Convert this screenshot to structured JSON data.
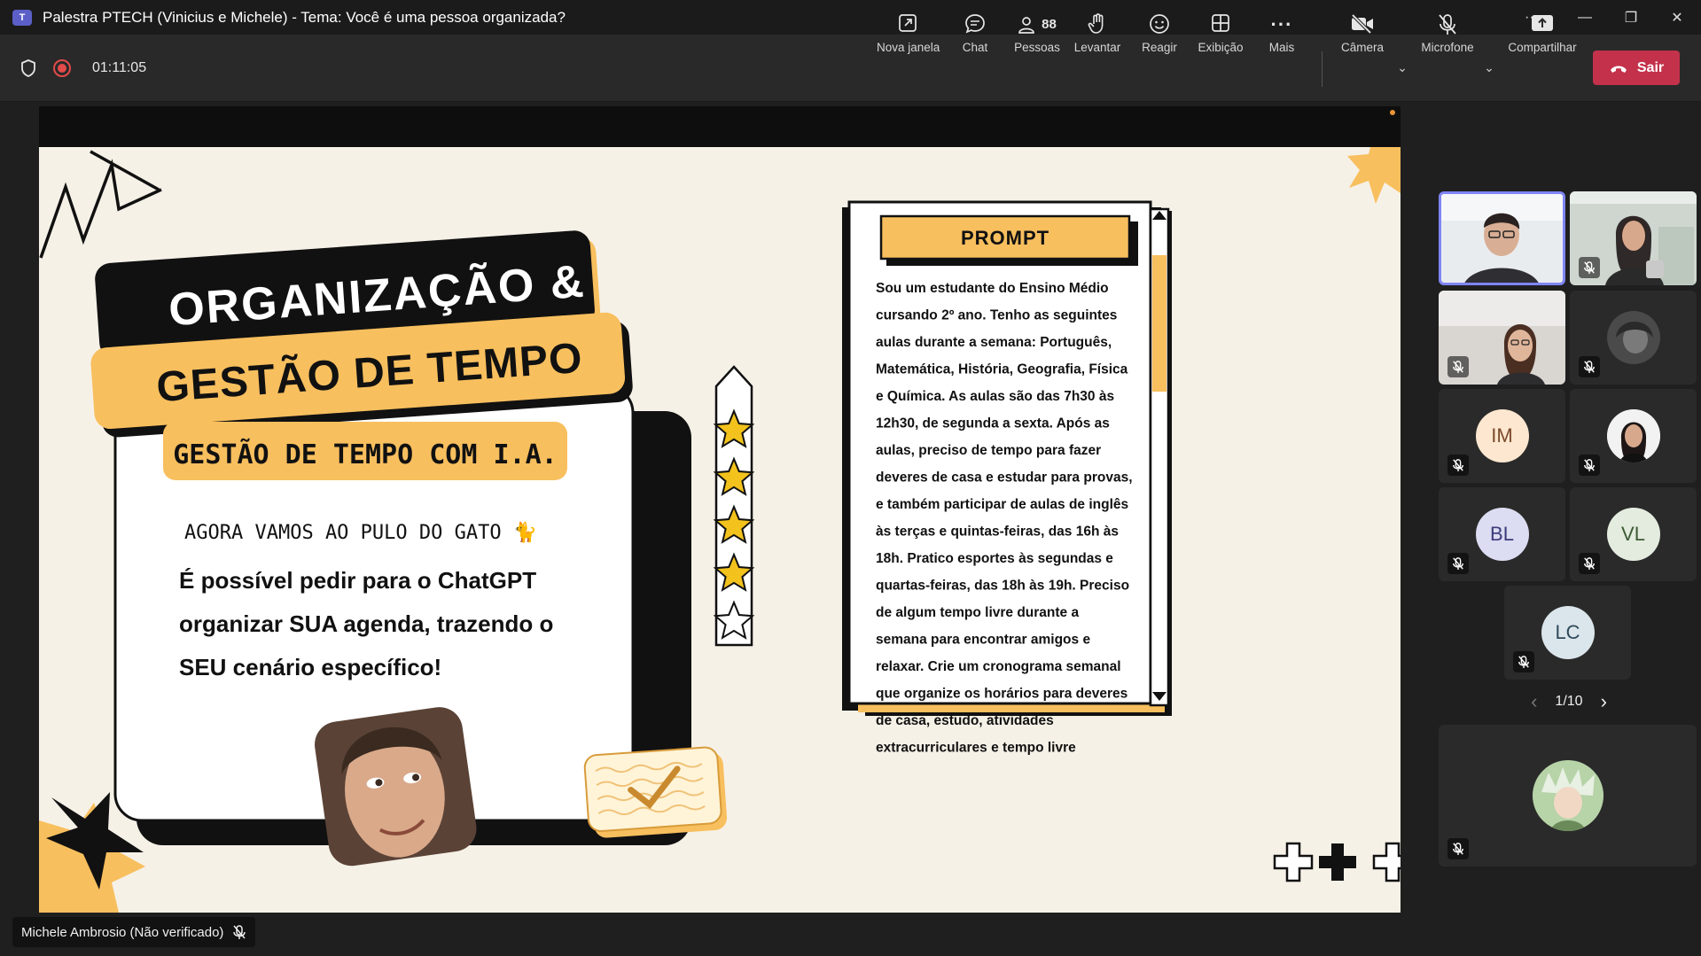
{
  "window": {
    "app_icon": "T",
    "title": "Palestra PTECH (Vinicius e Michele) - Tema: Você é uma pessoa organizada?",
    "controls": {
      "more": "···",
      "minimize": "—",
      "restore": "❐",
      "close": "✕"
    }
  },
  "toolbar": {
    "timer": "01:11:05",
    "buttons": {
      "new_window": "Nova janela",
      "chat": "Chat",
      "people": "Pessoas",
      "people_count": "88",
      "raise": "Levantar",
      "react": "Reagir",
      "view": "Exibição",
      "more": "Mais",
      "camera": "Câmera",
      "mic": "Microfone",
      "share": "Compartilhar",
      "leave": "Sair"
    }
  },
  "slide": {
    "title_line1": "ORGANIZAÇÃO &",
    "title_line2": "GESTÃO DE TEMPO",
    "subtitle": "GESTÃO DE TEMPO COM I.A.",
    "handwritten": "AGORA VAMOS AO PULO DO GATO 🐈",
    "body_lines": [
      "É possível pedir para o ChatGPT",
      "organizar SUA agenda, trazendo o",
      "SEU cenário específico!"
    ],
    "prompt_title": "PROMPT",
    "prompt_lines": [
      "Sou um estudante do Ensino Médio",
      "cursando 2º ano. Tenho as seguintes",
      "aulas durante a semana: Português,",
      "Matemática, História, Geografia, Física",
      "e Química. As aulas são das 7h30 às",
      "12h30, de segunda a sexta. Após as",
      "aulas, preciso de tempo para fazer",
      "deveres de casa e estudar para provas,",
      "e também participar de aulas de inglês",
      "às terças e quintas-feiras, das 16h às",
      "18h. Pratico esportes às segundas e",
      "quartas-feiras, das 18h às 19h. Preciso",
      "de algum tempo livre durante a",
      "semana para encontrar amigos e",
      "relaxar. Crie um cronograma semanal",
      "que organize os horários para deveres",
      "de casa, estudo, atividades",
      "extracurriculares e tempo livre"
    ],
    "rating_stars": 4,
    "rating_max": 5
  },
  "presenter": {
    "name": "Michele Ambrosio (Não verificado)"
  },
  "participants": {
    "initials": {
      "im": "IM",
      "bl": "BL",
      "vl": "VL",
      "lc": "LC"
    },
    "pager": {
      "label": "1/10",
      "prev": "‹",
      "next": "›"
    }
  },
  "colors": {
    "accent": "#f8bf5e",
    "leave": "#c4314b",
    "active_border": "#7f85f5"
  }
}
